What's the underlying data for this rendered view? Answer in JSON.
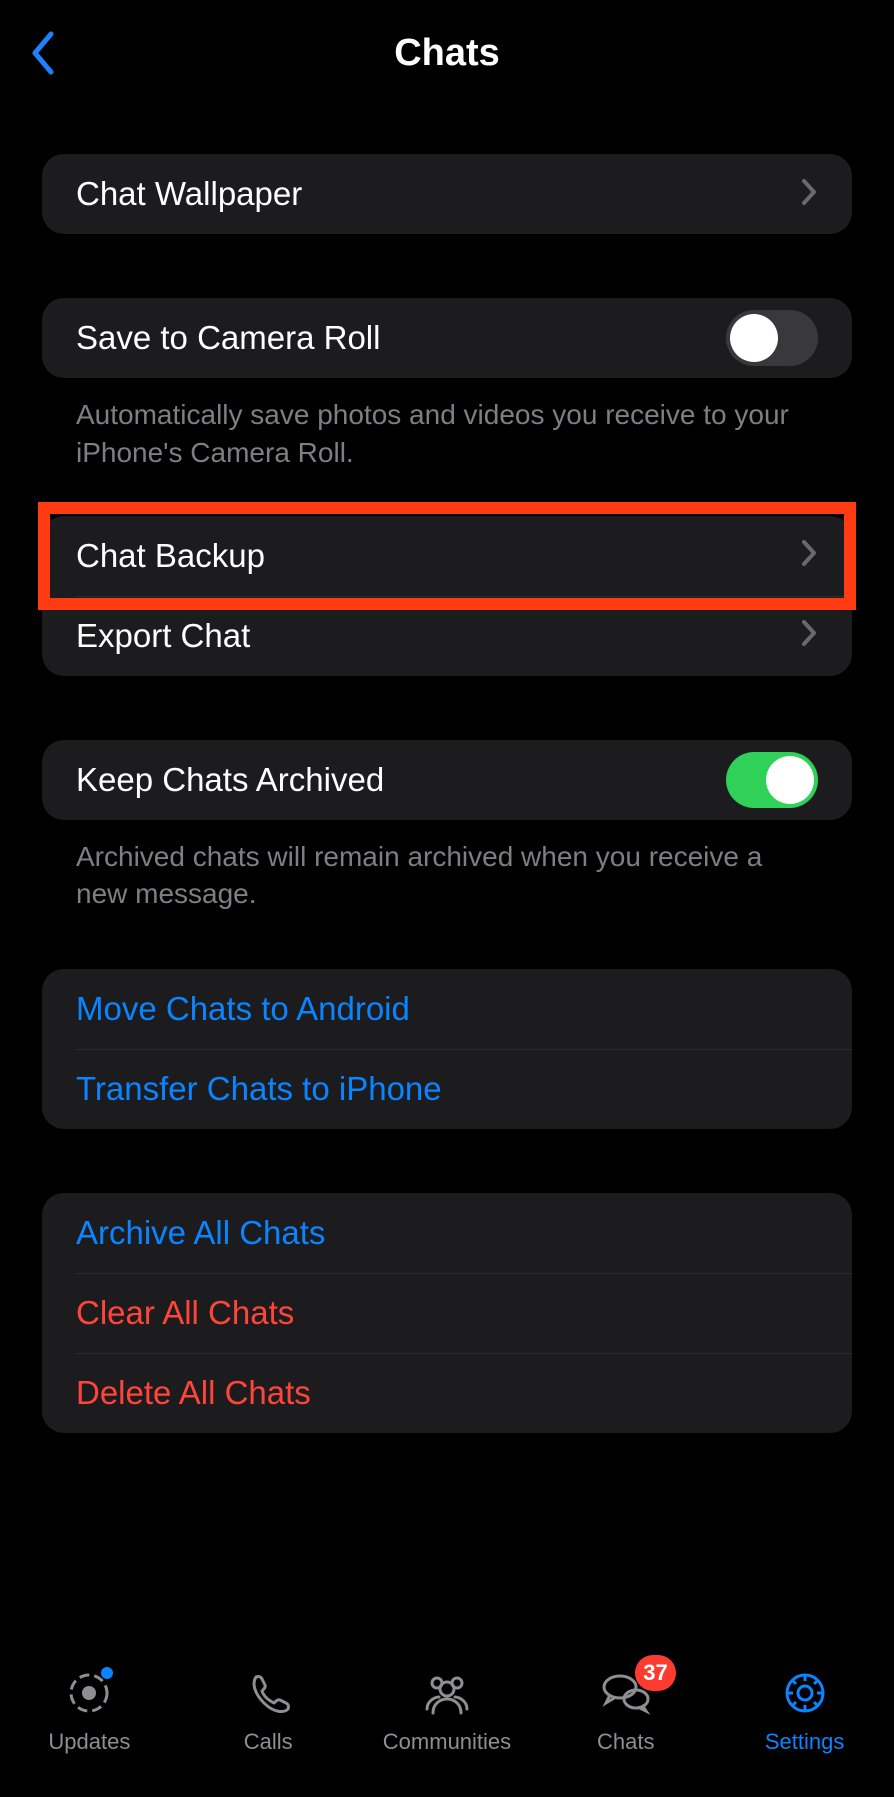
{
  "header": {
    "title": "Chats"
  },
  "section1": {
    "wallpaper": "Chat Wallpaper"
  },
  "section2": {
    "camera_roll": "Save to Camera Roll",
    "camera_roll_footer": "Automatically save photos and videos you receive to your iPhone's Camera Roll.",
    "chat_backup": "Chat Backup",
    "export_chat": "Export Chat"
  },
  "section3": {
    "keep_archived": "Keep Chats Archived",
    "keep_archived_footer": "Archived chats will remain archived when you receive a new message."
  },
  "section4": {
    "move_android": "Move Chats to Android",
    "transfer_iphone": "Transfer Chats to iPhone"
  },
  "section5": {
    "archive_all": "Archive All Chats",
    "clear_all": "Clear All Chats",
    "delete_all": "Delete All Chats"
  },
  "tabs": {
    "updates": "Updates",
    "calls": "Calls",
    "communities": "Communities",
    "chats": "Chats",
    "chats_badge": "37",
    "settings": "Settings"
  },
  "toggles": {
    "camera_roll_on": false,
    "keep_archived_on": true
  }
}
